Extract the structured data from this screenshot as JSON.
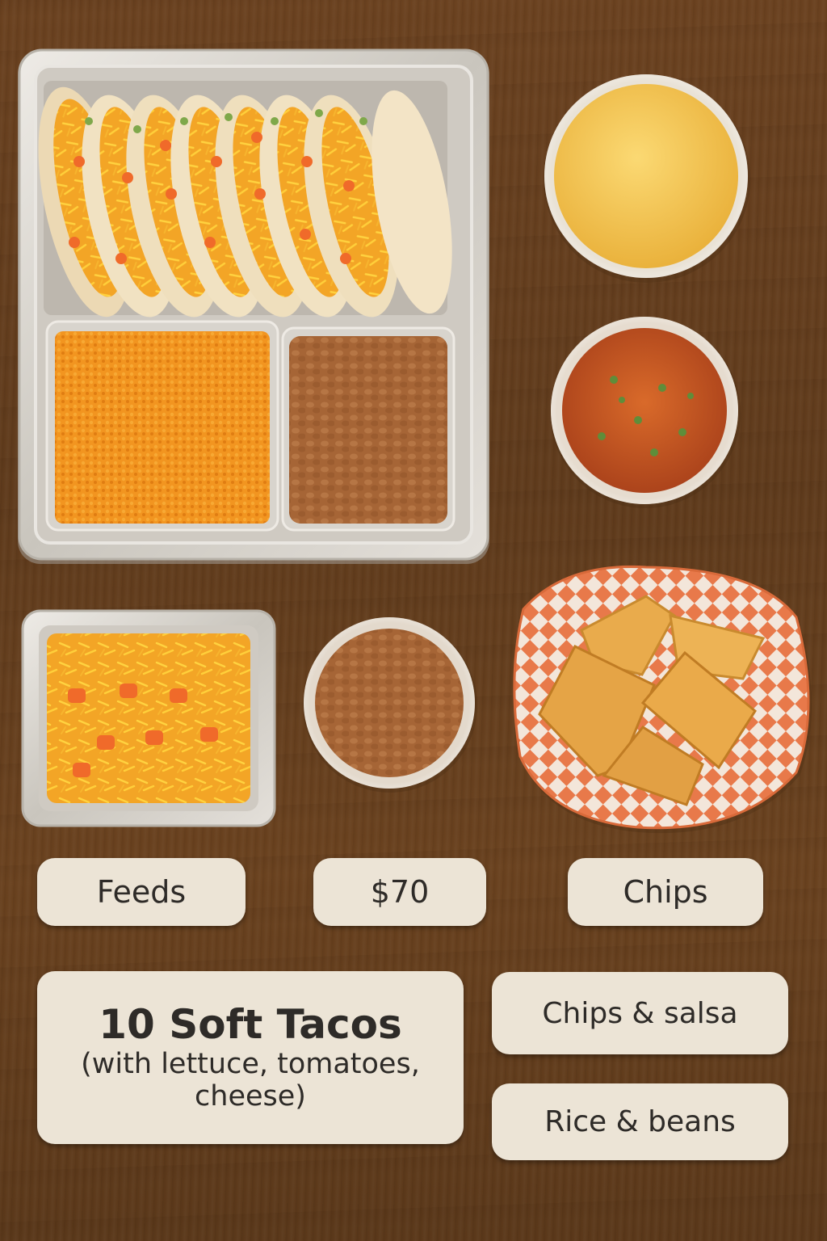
{
  "labels": {
    "feeds": "Feeds",
    "price": "$70",
    "chips": "Chips",
    "tacos_title": "10 Soft Tacos",
    "tacos_sub_1": "(with lettuce, tomatoes,",
    "tacos_sub_2": "cheese)",
    "chips_salsa": "Chips & salsa",
    "rice_beans": "Rice & beans"
  },
  "colors": {
    "table": "#5f3b1c",
    "label_bg": "#ece4d6",
    "label_text": "#2e2b28",
    "foil": "#d9d6d0",
    "queso": "#f2c04c",
    "salsa": "#c9541e",
    "beans": "#a86a3a",
    "rice": "#f0901e",
    "chip": "#e8a84a",
    "checker": "#e87a4a"
  }
}
